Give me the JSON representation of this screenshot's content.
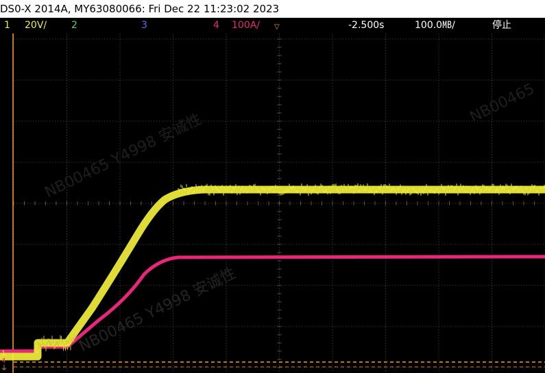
{
  "header": {
    "title": "DS0-X 2014A, MY63080066: Fri Dec 22 11:23:02 2023"
  },
  "status": {
    "ch1_num": "1",
    "ch1_scale": "20V/",
    "ch2_num": "2",
    "ch3_num": "3",
    "ch4_num": "4",
    "ch4_scale": "100A/",
    "time_offset": "-2.500s",
    "time_scale": "100.0㎆/",
    "run_state": "停止"
  },
  "watermark": {
    "upper": "NB00465  Y4998  安诚性",
    "lower": "NB00465  Y4998  安诚性",
    "right": "NB00465"
  },
  "colors": {
    "ch1": "#f2ef3a",
    "ch2": "#4cd66b",
    "ch3": "#5a6cf0",
    "ch4": "#e8267a",
    "grid": "#3a3a3a",
    "trigger": "#ff9a2a"
  },
  "markers": {
    "ground_label": "⏚"
  }
}
